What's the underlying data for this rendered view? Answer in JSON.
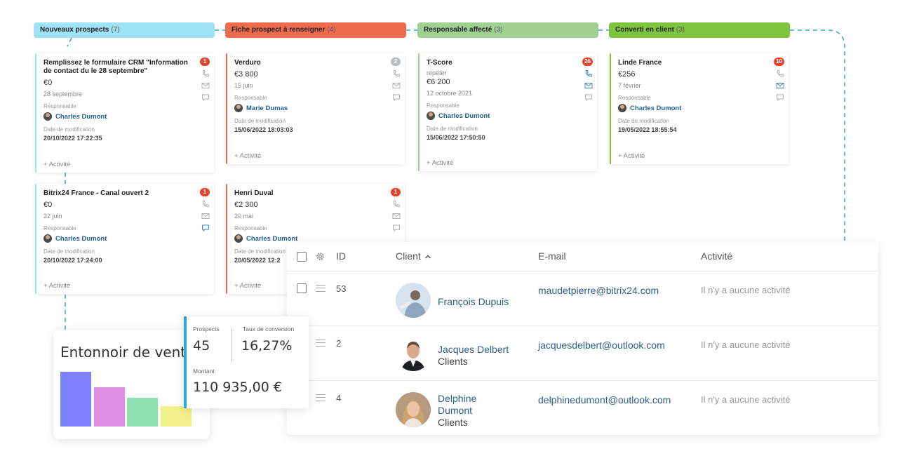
{
  "stages": [
    {
      "label": "Nouveaux prospects",
      "count": "(7)"
    },
    {
      "label": "Fiche prospect à renseigner",
      "count": "(4)"
    },
    {
      "label": "Responsable affecté",
      "count": "(3)"
    },
    {
      "label": "Converti en client",
      "count": "(3)"
    }
  ],
  "cards": [
    {
      "title": "Remplissez le formulaire CRM \"Information de contact du le 28 septembre\"",
      "badge": "1",
      "sub": "",
      "amount": "€0",
      "date": "28 septembre",
      "responsable_label": "Responsable",
      "person": "Charles Dumont",
      "mod_label": "Date de modification",
      "mod_date": "20/10/2022 17:22:35",
      "activity": "+ Activité"
    },
    {
      "title": "Verduro",
      "badge": "2",
      "sub": "",
      "amount": "€3 800",
      "date": "15 juin",
      "responsable_label": "Responsable",
      "person": "Marie Dumas",
      "mod_label": "Date de modification",
      "mod_date": "15/06/2022 18:03:03",
      "activity": "+ Activité"
    },
    {
      "title": "T-Score",
      "badge": "26",
      "sub": "répéter",
      "amount": "€6 200",
      "date": "12 octobre 2021",
      "responsable_label": "Responsable",
      "person": "Charles Dumont",
      "mod_label": "Date de modification",
      "mod_date": "15/06/2022 17:50:50",
      "activity": "+ Activité"
    },
    {
      "title": "Linde France",
      "badge": "10",
      "sub": "",
      "amount": "€256",
      "date": "7 février",
      "responsable_label": "Responsable",
      "person": "Charles Dumont",
      "mod_label": "Date de modification",
      "mod_date": "19/05/2022 18:55:54",
      "activity": "+ Activité"
    },
    {
      "title": "Bitrix24 France - Canal ouvert 2",
      "badge": "1",
      "sub": "",
      "amount": "€0",
      "date": "22 juin",
      "responsable_label": "Responsable",
      "person": "Charles Dumont",
      "mod_label": "Date de modification",
      "mod_date": "20/10/2022 17:24:00",
      "activity": "+ Activité"
    },
    {
      "title": "Henri Duval",
      "badge": "1",
      "sub": "",
      "amount": "€2 300",
      "date": "20 mai",
      "responsable_label": "Responsable",
      "person": "Charles Dumont",
      "mod_label": "Date de modification",
      "mod_date": "20/05/2022 12:2",
      "activity": "+ Activité"
    }
  ],
  "table": {
    "headers": {
      "id": "ID",
      "client": "Client",
      "client_sort_icon": "chevron-up-icon",
      "email": "E-mail",
      "activity": "Activité"
    },
    "rows": [
      {
        "id": "53",
        "name_line1": "François Dupuis",
        "name_line2": "",
        "sub": "",
        "email": "maudetpierre@bitrix24.com",
        "activity": "Il n'y a aucune activité"
      },
      {
        "id": "2",
        "name_line1": "Jacques Delbert",
        "name_line2": "",
        "sub": "Clients",
        "email": "jacquesdelbert@outlook.com",
        "activity": "Il n'y a aucune activité"
      },
      {
        "id": "4",
        "name_line1": "Delphine",
        "name_line2": "Dumont",
        "sub": "Clients",
        "email": "delphinedumont@outlook.com",
        "activity": "Il n'y a aucune activité"
      }
    ]
  },
  "funnel": {
    "title": "Entonnoir de ventes",
    "bar_levels": [
      1.0,
      0.72,
      0.53,
      0.37
    ],
    "bar_colors": [
      "#8080fb",
      "#e08ee0",
      "#8ee0b0",
      "#f2f08a"
    ]
  },
  "stats": {
    "prospects_label": "Prospects",
    "prospects_value": "45",
    "conversion_label": "Taux de conversion",
    "conversion_value": "16,27%",
    "amount_label": "Montant",
    "amount_value": "110 935,00 €"
  },
  "colors": {
    "accent_blue": "#2ea5dc",
    "link_blue": "#2d5f8b",
    "badge_red": "#e5432e"
  }
}
